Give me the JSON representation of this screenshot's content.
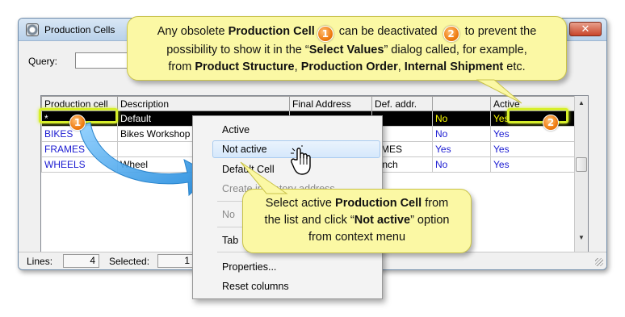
{
  "window": {
    "title": "Production Cells",
    "close_label": "✕"
  },
  "query": {
    "label": "Query:",
    "value": ""
  },
  "table": {
    "columns": [
      "Production cell",
      "Description",
      "Final Address",
      "Def. addr.",
      "",
      "Active"
    ],
    "rows": [
      {
        "cell": "*",
        "description": "Default",
        "final_address": "",
        "def_addr": "",
        "col5": "No",
        "active": "Yes"
      },
      {
        "cell": "BIKES",
        "description": "Bikes Workshop",
        "final_address": "",
        "def_addr": "",
        "col5": "No",
        "active": "Yes"
      },
      {
        "cell": "FRAMES",
        "description": "",
        "final_address": "",
        "def_addr": "AMES",
        "col5": "Yes",
        "active": "Yes"
      },
      {
        "cell": "WHEELS",
        "description": "Wheel",
        "final_address": "",
        "def_addr": "5inch",
        "col5": "No",
        "active": "Yes"
      }
    ]
  },
  "status": {
    "lines_label": "Lines:",
    "lines_value": "4",
    "selected_label": "Selected:",
    "selected_value": "1"
  },
  "context_menu": {
    "items": [
      "Active",
      "Not active",
      "Default Cell",
      "Create inventory address",
      "No",
      "Tab",
      "Properties...",
      "Reset columns"
    ]
  },
  "callouts": {
    "top": {
      "line1_a": "Any obsolete ",
      "line1_b": "Production Cell",
      "line1_c": " can be deactivated ",
      "line1_d": " to prevent the",
      "line2_a": "possibility to show it in the “",
      "line2_b": "Select Values",
      "line2_c": "” dialog called, for example,",
      "line3_a": "from ",
      "line3_b": "Product Structure",
      "line3_c": ", ",
      "line3_d": "Production Order",
      "line3_e": ", ",
      "line3_f": "Internal Shipment",
      "line3_g": " etc."
    },
    "middle": {
      "line1_a": "Select active ",
      "line1_b": "Production Cell",
      "line1_c": " from",
      "line2_a": "the list and click “",
      "line2_b": "Not active",
      "line2_c": "” option",
      "line3": "from context menu"
    }
  },
  "badges": {
    "one": "1",
    "two": "2"
  },
  "colors": {
    "callout_fill": "#fbf8a4",
    "badge_orange": "#f07d12",
    "highlight": "#d7ef2a",
    "arrow_blue": "#2f9be8",
    "link_blue": "#1b1bd1",
    "selected_text": "#ffff00"
  },
  "icons": [
    "app-icon",
    "hand-cursor-icon",
    "arrow-icon",
    "close-icon"
  ]
}
